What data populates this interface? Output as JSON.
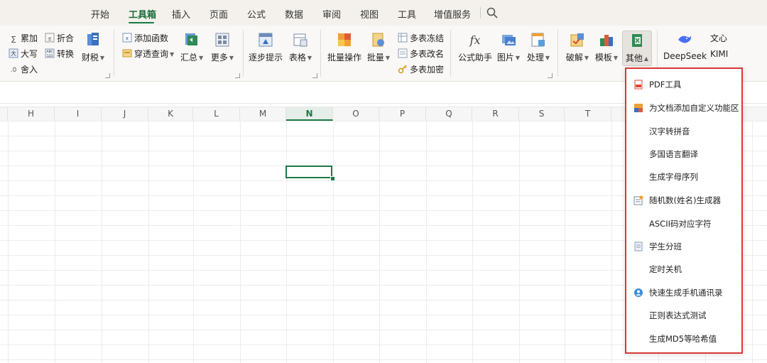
{
  "tabs": [
    "开始",
    "工具箱",
    "插入",
    "页面",
    "公式",
    "数据",
    "审阅",
    "视图",
    "工具",
    "增值服务"
  ],
  "active_tab": "工具箱",
  "ribbon": {
    "sum_label": "累加",
    "upper_label": "大写",
    "round_label": "舍入",
    "fold_label": "折合",
    "convert_label": "转换",
    "finance_label": "财税",
    "add_func_label": "添加函数",
    "penetrate_label": "穿透查询",
    "summary_label": "汇总",
    "more_label": "更多",
    "step_hint_label": "逐步提示",
    "table_label": "表格",
    "batch_op_label": "批量操作",
    "batch_label": "批量",
    "freeze_label": "多表冻结",
    "rename_label": "多表改名",
    "encrypt_label": "多表加密",
    "formula_helper_label": "公式助手",
    "picture_label": "图片",
    "process_label": "处理",
    "crack_label": "破解",
    "template_label": "模板",
    "other_label": "其他",
    "deepseek_label": "DeepSeek",
    "wenxin_label": "文心",
    "kimi_label": "KIMI"
  },
  "columns": [
    "H",
    "I",
    "J",
    "K",
    "L",
    "M",
    "N",
    "O",
    "P",
    "Q",
    "R",
    "S",
    "T"
  ],
  "selected_column": "N",
  "dropdown": {
    "items": [
      {
        "label": "PDF工具",
        "icon": "pdf-icon"
      },
      {
        "label": "为文档添加自定义功能区",
        "icon": "ribbon-custom-icon"
      },
      {
        "label": "汉字转拼音",
        "icon": ""
      },
      {
        "label": "多国语言翻译",
        "icon": ""
      },
      {
        "label": "生成字母序列",
        "icon": ""
      },
      {
        "label": "随机数(姓名)生成器",
        "icon": "random-generator-icon"
      },
      {
        "label": "ASCII码对应字符",
        "icon": ""
      },
      {
        "label": "学生分班",
        "icon": "student-class-icon"
      },
      {
        "label": "定时关机",
        "icon": ""
      },
      {
        "label": "快速生成手机通讯录",
        "icon": "contacts-icon"
      },
      {
        "label": "正则表达式测试",
        "icon": ""
      },
      {
        "label": "生成MD5等哈希值",
        "icon": ""
      }
    ]
  },
  "colors": {
    "accent": "#1a7a44",
    "dropdown_border": "#d93838"
  }
}
